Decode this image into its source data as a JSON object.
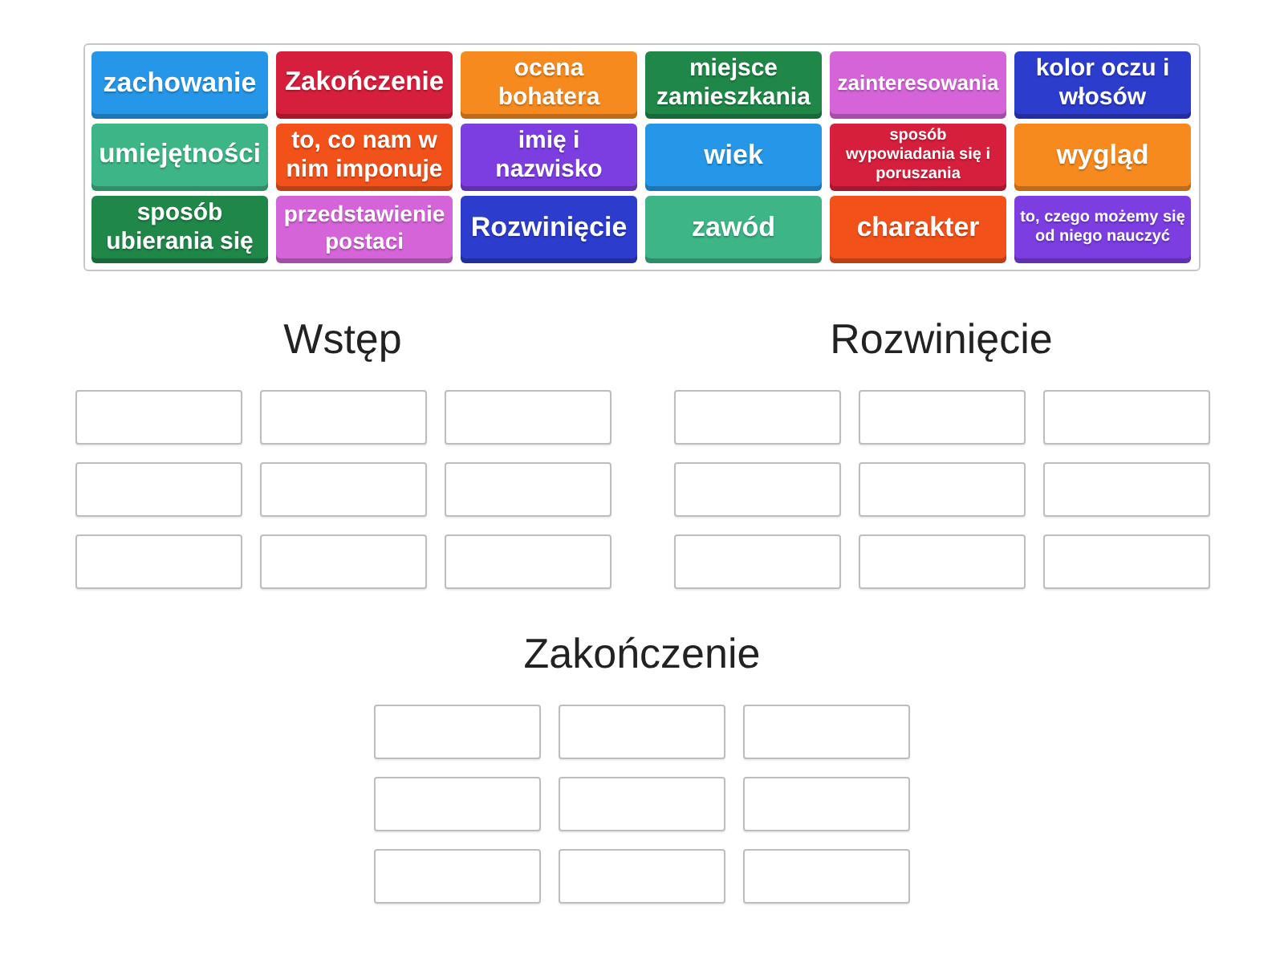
{
  "tiles": [
    {
      "label": "zachowanie",
      "color": "#2596e8"
    },
    {
      "label": "Zakończenie",
      "color": "#d61f3c"
    },
    {
      "label": "ocena bohatera",
      "color": "#f68a1e"
    },
    {
      "label": "miejsce zamieszkania",
      "color": "#1f8748"
    },
    {
      "label": "zainteresowania",
      "color": "#d464d8"
    },
    {
      "label": "kolor oczu i włosów",
      "color": "#2c3ccc"
    },
    {
      "label": "umiejętności",
      "color": "#3db586"
    },
    {
      "label": "to, co nam w nim imponuje",
      "color": "#f2511a"
    },
    {
      "label": "imię i nazwisko",
      "color": "#7c3ee0"
    },
    {
      "label": "wiek",
      "color": "#2596e8"
    },
    {
      "label": "sposób wypowiadania się i poruszania",
      "color": "#d61f3c"
    },
    {
      "label": "wygląd",
      "color": "#f68a1e"
    },
    {
      "label": "sposób ubierania się",
      "color": "#1f8748"
    },
    {
      "label": "przedstawienie postaci",
      "color": "#d464d8"
    },
    {
      "label": "Rozwinięcie",
      "color": "#2c3ccc"
    },
    {
      "label": "zawód",
      "color": "#3db586"
    },
    {
      "label": "charakter",
      "color": "#f2511a"
    },
    {
      "label": "to, czego możemy się od niego nauczyć",
      "color": "#7c3ee0"
    }
  ],
  "groups": [
    {
      "title": "Wstęp",
      "slots": [
        {
          "kind": "empty"
        },
        {
          "kind": "empty"
        },
        {
          "kind": "empty"
        },
        {
          "kind": "empty"
        },
        {
          "kind": "empty"
        },
        {
          "kind": "empty"
        },
        {
          "kind": "empty"
        },
        {
          "kind": "empty"
        },
        {
          "kind": "empty"
        }
      ]
    },
    {
      "title": "Rozwinięcie",
      "slots": [
        {
          "kind": "empty"
        },
        {
          "kind": "empty"
        },
        {
          "kind": "empty"
        },
        {
          "kind": "empty"
        },
        {
          "kind": "empty"
        },
        {
          "kind": "empty"
        },
        {
          "kind": "empty"
        },
        {
          "kind": "empty"
        },
        {
          "kind": "empty"
        }
      ]
    },
    {
      "title": "Zakończenie",
      "slots": [
        {
          "kind": "empty"
        },
        {
          "kind": "empty"
        },
        {
          "kind": "empty"
        },
        {
          "kind": "empty"
        },
        {
          "kind": "empty"
        },
        {
          "kind": "empty"
        },
        {
          "kind": "empty"
        },
        {
          "kind": "empty"
        },
        {
          "kind": "empty"
        }
      ]
    }
  ]
}
